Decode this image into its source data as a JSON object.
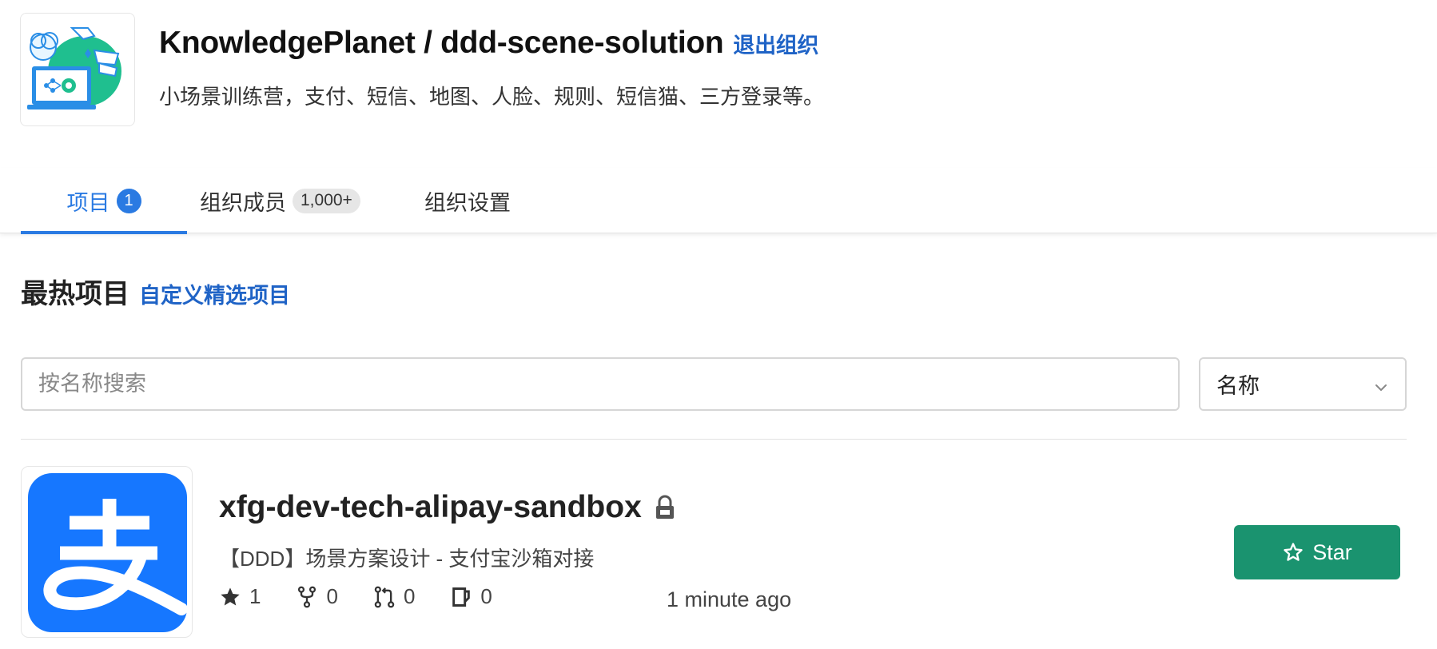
{
  "header": {
    "title": "KnowledgePlanet / ddd-scene-solution",
    "leave_link": "退出组织",
    "description": "小场景训练营，支付、短信、地图、人脸、规则、短信猫、三方登录等。",
    "avatar_icon": "org-illustration-icon"
  },
  "tabs": [
    {
      "label": "项目",
      "badge": "1",
      "active": true
    },
    {
      "label": "组织成员",
      "badge": "1,000+",
      "active": false
    },
    {
      "label": "组织设置",
      "active": false
    }
  ],
  "section": {
    "title": "最热项目",
    "custom_link": "自定义精选项目"
  },
  "search": {
    "placeholder": "按名称搜索",
    "value": ""
  },
  "sort": {
    "selected": "名称",
    "icon": "chevron-down-icon"
  },
  "projects": [
    {
      "name": "xfg-dev-tech-alipay-sandbox",
      "description": "【DDD】场景方案设计 - 支付宝沙箱对接",
      "avatar_glyph": "支",
      "private": true,
      "stars": "1",
      "forks": "0",
      "pull_requests": "0",
      "issues": "0",
      "updated": "1 minute ago",
      "star_button_label": "Star"
    }
  ],
  "colors": {
    "accent": "#2a7ae2",
    "link": "#1f63c6",
    "star_button": "#1a936f",
    "alipay_blue": "#1677ff"
  }
}
